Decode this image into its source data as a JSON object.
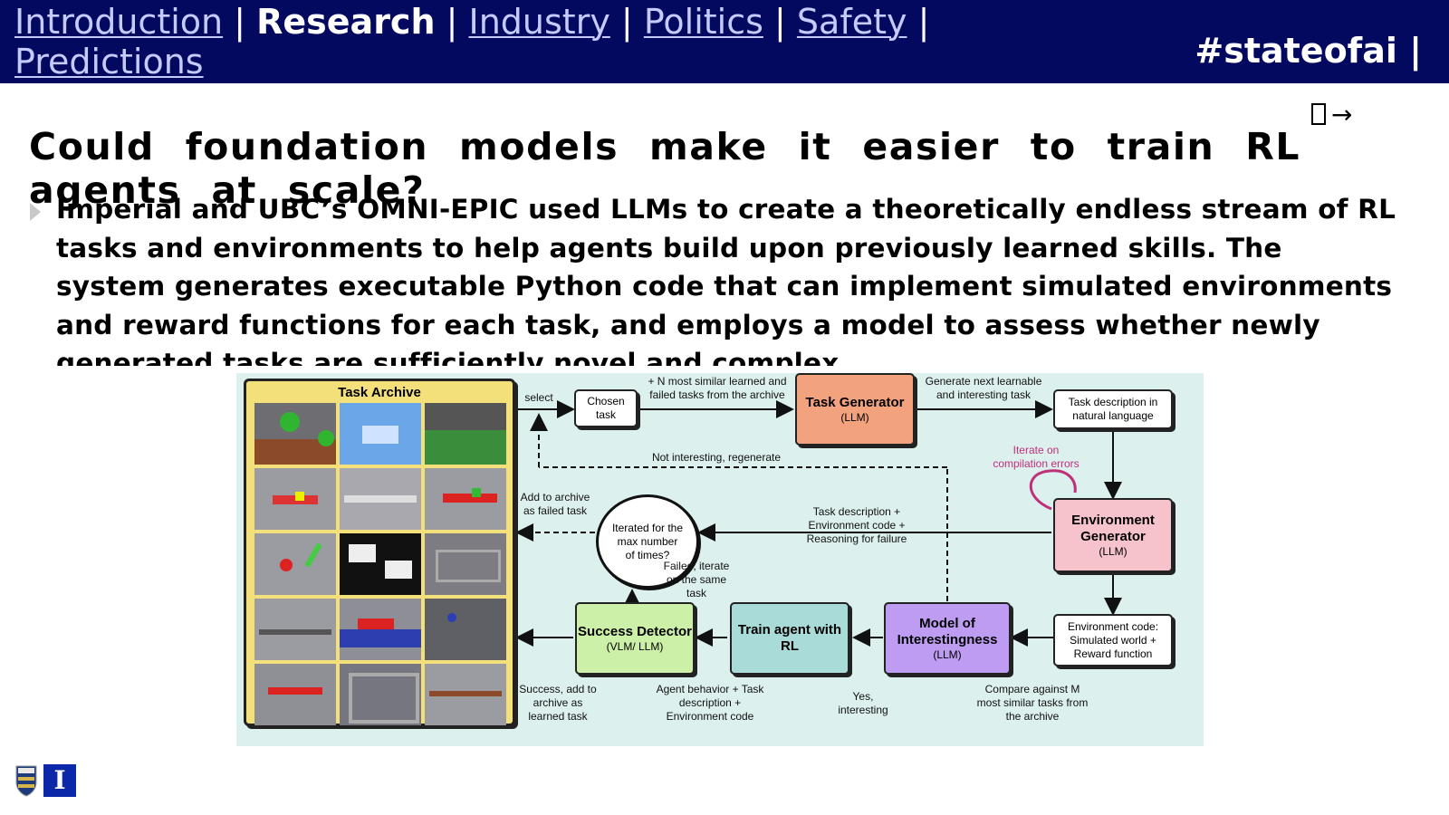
{
  "nav": {
    "items": [
      {
        "label": "Introduction",
        "current": false
      },
      {
        "label": "Research",
        "current": true
      },
      {
        "label": "Industry",
        "current": false
      },
      {
        "label": "Politics",
        "current": false
      },
      {
        "label": "Safety",
        "current": false
      },
      {
        "label": "Predictions",
        "current": false
      }
    ],
    "separator": "|",
    "hashtag": "#stateofai |"
  },
  "next_arrow": "→",
  "slide": {
    "title": "Could foundation models make it easier to train RL agents at scale?",
    "bullet": "Imperial and UBC’s OMNI-EPIC used LLMs to create a theoretically endless stream of RL tasks and environments to help agents build upon previously learned skills. The system generates executable Python code that can implement simulated environments and reward functions for each task, and employs a model to assess whether newly generated tasks are sufficiently novel and complex."
  },
  "figure": {
    "archive_title": "Task Archive",
    "nodes": {
      "chosen_task": "Chosen task",
      "task_generator": {
        "name": "Task Generator",
        "sub": "(LLM)"
      },
      "task_description": "Task description in natural language",
      "environment_generator": {
        "name": "Environment Generator",
        "sub": "(LLM)"
      },
      "environment_code": "Environment code: Simulated world + Reward function",
      "model_of_interestingness": {
        "name": "Model of Interestingness",
        "sub": "(LLM)"
      },
      "train_agent": {
        "name": "Train agent with RL"
      },
      "success_detector": {
        "name": "Success Detector",
        "sub": "(VLM/ LLM)"
      },
      "iterated": "Iterated for the max number of times?"
    },
    "labels": {
      "select": "select",
      "similar": "+ N most similar learned and failed tasks from the archive",
      "generate_next": "Generate next learnable and interesting task",
      "not_interesting": "Not interesting, regenerate",
      "iterate_errors": "Iterate on compilation errors",
      "add_failed": "Add to archive as failed task",
      "task_desc_env": "Task description + Environment code + Reasoning for failure",
      "failed_iterate": "Failed, iterate on the same task",
      "success_add": "Success, add to archive as learned task",
      "agent_behavior": "Agent behavior + Task description + Environment code",
      "yes_interesting": "Yes, interesting",
      "compare": "Compare against M most similar tasks from the archive"
    },
    "colors": {
      "background": "#dcf0ee",
      "archive": "#f3e07b",
      "task_generator": "#f2a37e",
      "environment_generator": "#f6c3cc",
      "interestingness": "#bd9cf2",
      "train_agent": "#a9dcd8",
      "success_detector": "#cdf0a8",
      "iterate_note": "#c02f7a"
    }
  },
  "logos": {
    "imperial_letter": "I"
  }
}
